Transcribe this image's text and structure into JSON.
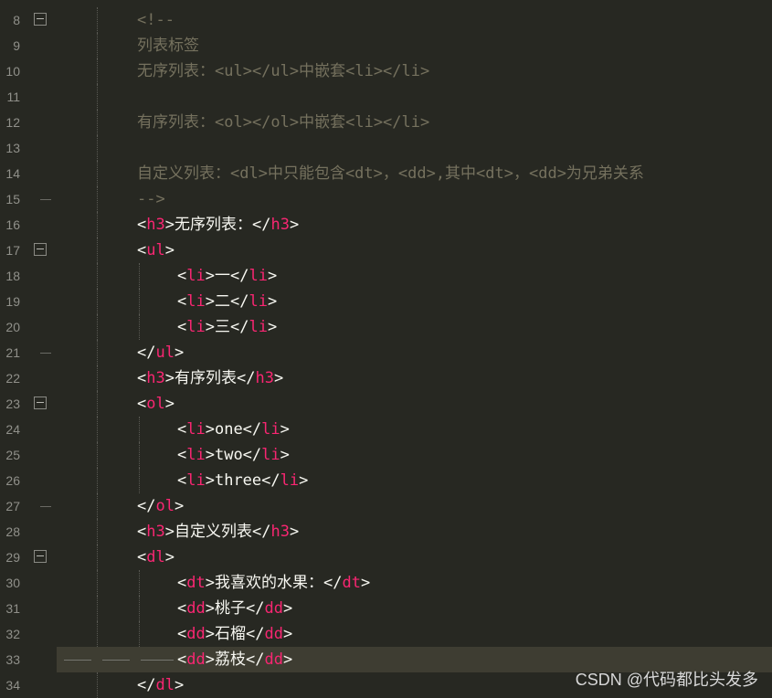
{
  "editor": {
    "colors": {
      "background": "#272822",
      "comment": "#75715e",
      "tag": "#f92672",
      "text": "#f8f8f2",
      "line_number": "#90908a",
      "current_line": "#3e3d32"
    },
    "lines": [
      {
        "num": "8",
        "fold": "start",
        "indent": 0,
        "tokens": [
          {
            "t": "<!--",
            "k": "comment"
          }
        ]
      },
      {
        "num": "9",
        "indent": 0,
        "tokens": [
          {
            "t": "列表标签",
            "k": "comment"
          }
        ]
      },
      {
        "num": "10",
        "indent": 0,
        "tokens": [
          {
            "t": "无序列表：<ul></ul>中嵌套<li></li>",
            "k": "comment"
          }
        ]
      },
      {
        "num": "11",
        "indent": 0,
        "tokens": []
      },
      {
        "num": "12",
        "indent": 0,
        "tokens": [
          {
            "t": "有序列表：<ol></ol>中嵌套<li></li>",
            "k": "comment"
          }
        ]
      },
      {
        "num": "13",
        "indent": 0,
        "tokens": []
      },
      {
        "num": "14",
        "indent": 0,
        "tokens": [
          {
            "t": "自定义列表：<dl>中只能包含<dt>，<dd>,其中<dt>，<dd>为兄弟关系",
            "k": "comment"
          }
        ]
      },
      {
        "num": "15",
        "fold": "end",
        "indent": 0,
        "tokens": [
          {
            "t": "-->",
            "k": "comment"
          }
        ]
      },
      {
        "num": "16",
        "indent": 0,
        "tokens": [
          {
            "t": "<",
            "k": "punct"
          },
          {
            "t": "h3",
            "k": "tag"
          },
          {
            "t": ">无序列表：</",
            "k": "punct"
          },
          {
            "t": "h3",
            "k": "tag"
          },
          {
            "t": ">",
            "k": "punct"
          }
        ]
      },
      {
        "num": "17",
        "fold": "start",
        "indent": 0,
        "tokens": [
          {
            "t": "<",
            "k": "punct"
          },
          {
            "t": "ul",
            "k": "tag"
          },
          {
            "t": ">",
            "k": "punct"
          }
        ]
      },
      {
        "num": "18",
        "indent": 1,
        "tokens": [
          {
            "t": "<",
            "k": "punct"
          },
          {
            "t": "li",
            "k": "tag"
          },
          {
            "t": ">一</",
            "k": "punct"
          },
          {
            "t": "li",
            "k": "tag"
          },
          {
            "t": ">",
            "k": "punct"
          }
        ]
      },
      {
        "num": "19",
        "indent": 1,
        "tokens": [
          {
            "t": "<",
            "k": "punct"
          },
          {
            "t": "li",
            "k": "tag"
          },
          {
            "t": ">二</",
            "k": "punct"
          },
          {
            "t": "li",
            "k": "tag"
          },
          {
            "t": ">",
            "k": "punct"
          }
        ]
      },
      {
        "num": "20",
        "indent": 1,
        "tokens": [
          {
            "t": "<",
            "k": "punct"
          },
          {
            "t": "li",
            "k": "tag"
          },
          {
            "t": ">三</",
            "k": "punct"
          },
          {
            "t": "li",
            "k": "tag"
          },
          {
            "t": ">",
            "k": "punct"
          }
        ]
      },
      {
        "num": "21",
        "fold": "end",
        "indent": 0,
        "tokens": [
          {
            "t": "</",
            "k": "punct"
          },
          {
            "t": "ul",
            "k": "tag"
          },
          {
            "t": ">",
            "k": "punct"
          }
        ]
      },
      {
        "num": "22",
        "indent": 0,
        "tokens": [
          {
            "t": "<",
            "k": "punct"
          },
          {
            "t": "h3",
            "k": "tag"
          },
          {
            "t": ">有序列表</",
            "k": "punct"
          },
          {
            "t": "h3",
            "k": "tag"
          },
          {
            "t": ">",
            "k": "punct"
          }
        ]
      },
      {
        "num": "23",
        "fold": "start",
        "indent": 0,
        "tokens": [
          {
            "t": "<",
            "k": "punct"
          },
          {
            "t": "ol",
            "k": "tag"
          },
          {
            "t": ">",
            "k": "punct"
          }
        ]
      },
      {
        "num": "24",
        "indent": 1,
        "tokens": [
          {
            "t": "<",
            "k": "punct"
          },
          {
            "t": "li",
            "k": "tag"
          },
          {
            "t": ">one</",
            "k": "punct"
          },
          {
            "t": "li",
            "k": "tag"
          },
          {
            "t": ">",
            "k": "punct"
          }
        ]
      },
      {
        "num": "25",
        "indent": 1,
        "tokens": [
          {
            "t": "<",
            "k": "punct"
          },
          {
            "t": "li",
            "k": "tag"
          },
          {
            "t": ">two</",
            "k": "punct"
          },
          {
            "t": "li",
            "k": "tag"
          },
          {
            "t": ">",
            "k": "punct"
          }
        ]
      },
      {
        "num": "26",
        "indent": 1,
        "tokens": [
          {
            "t": "<",
            "k": "punct"
          },
          {
            "t": "li",
            "k": "tag"
          },
          {
            "t": ">three</",
            "k": "punct"
          },
          {
            "t": "li",
            "k": "tag"
          },
          {
            "t": ">",
            "k": "punct"
          }
        ]
      },
      {
        "num": "27",
        "fold": "end",
        "indent": 0,
        "tokens": [
          {
            "t": "</",
            "k": "punct"
          },
          {
            "t": "ol",
            "k": "tag"
          },
          {
            "t": ">",
            "k": "punct"
          }
        ]
      },
      {
        "num": "28",
        "indent": 0,
        "tokens": [
          {
            "t": "<",
            "k": "punct"
          },
          {
            "t": "h3",
            "k": "tag"
          },
          {
            "t": ">自定义列表</",
            "k": "punct"
          },
          {
            "t": "h3",
            "k": "tag"
          },
          {
            "t": ">",
            "k": "punct"
          }
        ]
      },
      {
        "num": "29",
        "fold": "start",
        "indent": 0,
        "tokens": [
          {
            "t": "<",
            "k": "punct"
          },
          {
            "t": "dl",
            "k": "tag"
          },
          {
            "t": ">",
            "k": "punct"
          }
        ]
      },
      {
        "num": "30",
        "indent": 1,
        "tokens": [
          {
            "t": "<",
            "k": "punct"
          },
          {
            "t": "dt",
            "k": "tag"
          },
          {
            "t": ">我喜欢的水果：</",
            "k": "punct"
          },
          {
            "t": "dt",
            "k": "tag"
          },
          {
            "t": ">",
            "k": "punct"
          }
        ]
      },
      {
        "num": "31",
        "indent": 1,
        "tokens": [
          {
            "t": "<",
            "k": "punct"
          },
          {
            "t": "dd",
            "k": "tag"
          },
          {
            "t": ">桃子</",
            "k": "punct"
          },
          {
            "t": "dd",
            "k": "tag"
          },
          {
            "t": ">",
            "k": "punct"
          }
        ]
      },
      {
        "num": "32",
        "indent": 1,
        "tokens": [
          {
            "t": "<",
            "k": "punct"
          },
          {
            "t": "dd",
            "k": "tag"
          },
          {
            "t": ">石榴</",
            "k": "punct"
          },
          {
            "t": "dd",
            "k": "tag"
          },
          {
            "t": ">",
            "k": "punct"
          }
        ]
      },
      {
        "num": "33",
        "indent": 1,
        "current": true,
        "tokens": [
          {
            "t": "<",
            "k": "punct"
          },
          {
            "t": "dd",
            "k": "tag"
          },
          {
            "t": ">荔枝</",
            "k": "punct"
          },
          {
            "t": "dd",
            "k": "tag"
          },
          {
            "t": ">",
            "k": "punct"
          }
        ]
      },
      {
        "num": "34",
        "indent": 0,
        "tokens": [
          {
            "t": "</",
            "k": "punct"
          },
          {
            "t": "dl",
            "k": "tag"
          },
          {
            "t": ">",
            "k": "punct"
          }
        ]
      }
    ]
  },
  "watermark": {
    "text": "CSDN @代码都比头发多"
  }
}
